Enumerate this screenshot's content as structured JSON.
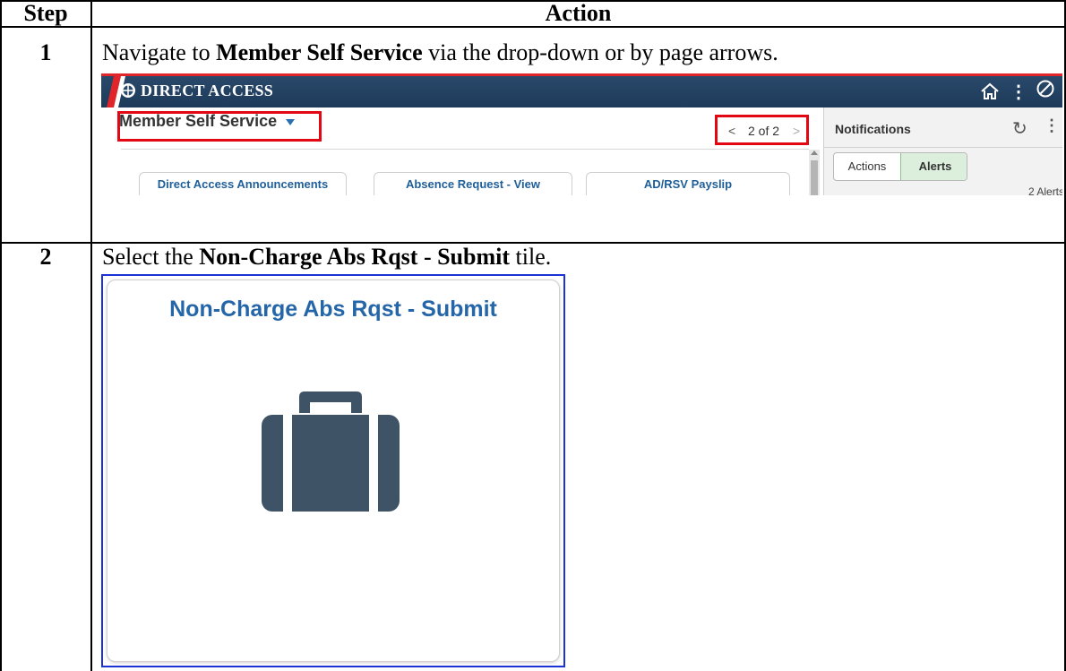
{
  "table": {
    "header_step": "Step",
    "header_action": "Action",
    "rows": [
      {
        "step": "1",
        "text_before": "Navigate to ",
        "text_bold": "Member Self Service",
        "text_after": " via the drop-down or by page arrows."
      },
      {
        "step": "2",
        "text_before": "Select the ",
        "text_bold": "Non-Charge Abs Rqst - Submit",
        "text_after": " tile."
      }
    ]
  },
  "screenshot1": {
    "app_title": "DIRECT ACCESS",
    "homepage_selector": "Member Self Service",
    "pager": "2 of 2",
    "tiles": [
      "Direct Access Announcements",
      "Absence Request - View",
      "AD/RSV Payslip"
    ],
    "notifications": {
      "title": "Notifications",
      "tab_actions": "Actions",
      "tab_alerts": "Alerts",
      "count": "2 Alerts"
    },
    "icons": [
      "home-icon",
      "kebab-menu-icon",
      "no-entry-icon",
      "refresh-icon",
      "chevron-left-icon",
      "chevron-right-icon",
      "caret-down-icon"
    ],
    "colors": {
      "banner": "#1d3a5a",
      "highlight": "#e30613",
      "link": "#1f5f99"
    }
  },
  "screenshot2": {
    "tile_title": "Non-Charge Abs Rqst - Submit",
    "tile_icon": "briefcase-icon",
    "colors": {
      "title": "#2466a8",
      "icon": "#3f5366",
      "selection": "#1a33d6"
    }
  }
}
